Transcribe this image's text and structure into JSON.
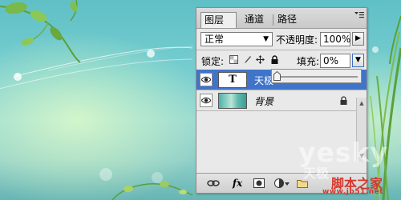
{
  "panel": {
    "tabs": [
      {
        "label": "图层",
        "close": "×"
      },
      {
        "label": "通道"
      },
      {
        "label": "路径"
      }
    ],
    "menu_icon": "panel-menu-icon",
    "blend_mode": "正常",
    "opacity_label": "不透明度:",
    "opacity_value": "100%",
    "lock_label": "锁定:",
    "fill_label": "填充:",
    "fill_value": "0%",
    "layers": [
      {
        "name": "天极",
        "thumb_text": "T",
        "type": "text",
        "selected": true
      },
      {
        "name": "背景",
        "type": "image",
        "locked": true
      }
    ],
    "fill_slider": {
      "value": 0
    },
    "bottom_icons": [
      "link-icon",
      "fx-icon",
      "mask-icon",
      "adjustment-icon",
      "folder-icon"
    ],
    "fx_label": "fx"
  },
  "watermark": {
    "brand": "yesky",
    "brand_cn": "天极",
    "site_cn": "脚本之家",
    "site_url": "www.jb51.net"
  },
  "colors": {
    "selection": "#3f74c9",
    "panel_bg": "#e9e9e9",
    "watermark_red": "#d5382c"
  }
}
